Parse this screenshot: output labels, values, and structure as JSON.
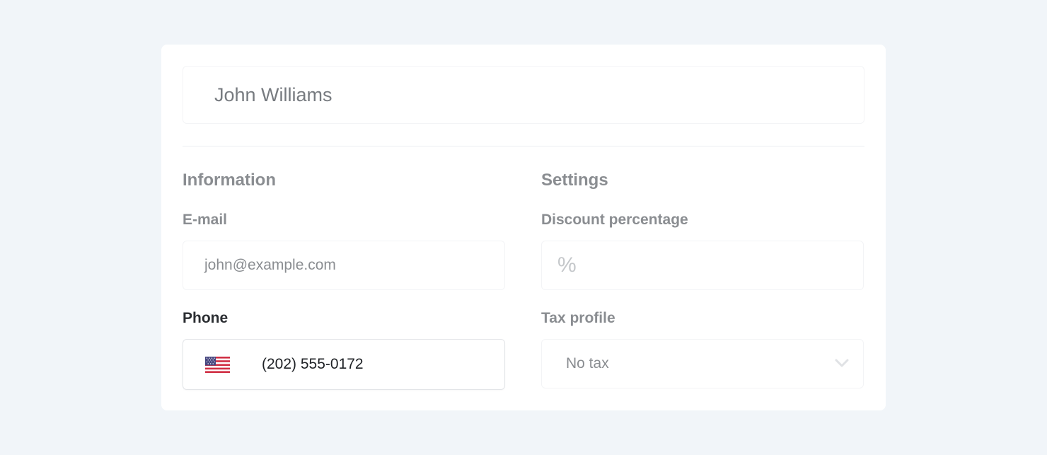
{
  "customer": {
    "name": "John Williams"
  },
  "information": {
    "title": "Information",
    "email_label": "E-mail",
    "email_value": "john@example.com",
    "phone_label": "Phone",
    "phone_value": "(202) 555-0172",
    "phone_country_icon": "us-flag-icon"
  },
  "settings": {
    "title": "Settings",
    "discount_label": "Discount percentage",
    "discount_icon_symbol": "%",
    "tax_label": "Tax profile",
    "tax_value": "No tax"
  },
  "colors": {
    "background": "#f1f5f9",
    "card": "#ffffff",
    "muted_text": "#8a8d91",
    "dark_text": "#1f2226"
  }
}
